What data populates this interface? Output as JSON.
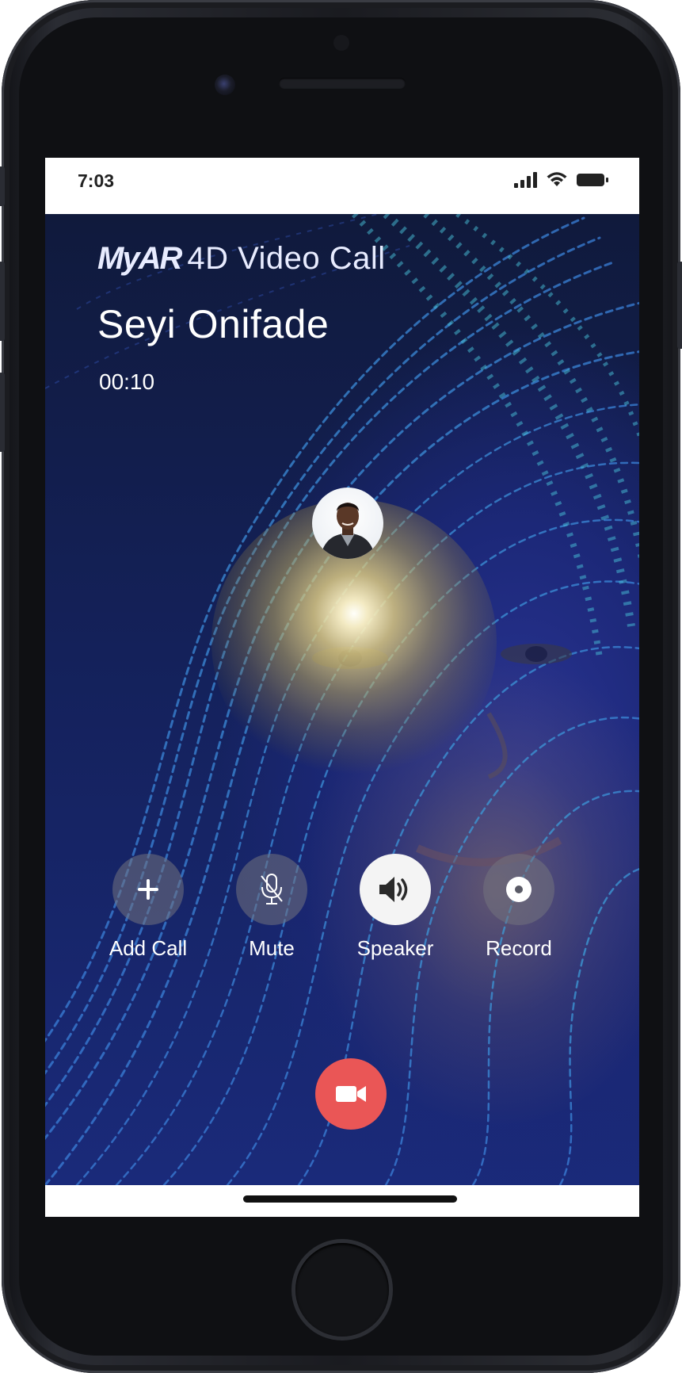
{
  "status_bar": {
    "time": "7:03",
    "signal_icon": "cellular-signal-icon",
    "wifi_icon": "wifi-icon",
    "battery_icon": "battery-icon"
  },
  "call": {
    "brand_logo": "MyAR",
    "brand_title": "4D Video Call",
    "caller_name": "Seyi Onifade",
    "duration": "00:10"
  },
  "controls": [
    {
      "label": "Add Call",
      "icon": "plus-icon",
      "active": false
    },
    {
      "label": "Mute",
      "icon": "mic-off-icon",
      "active": false
    },
    {
      "label": "Speaker",
      "icon": "speaker-icon",
      "active": true
    },
    {
      "label": "Record",
      "icon": "record-icon",
      "active": false
    }
  ],
  "end_call": {
    "icon": "video-camera-icon",
    "color": "#ea5656"
  },
  "colors": {
    "end_call_red": "#ea5656",
    "control_circle": "#73737d",
    "active_control": "#f4f4f4"
  }
}
